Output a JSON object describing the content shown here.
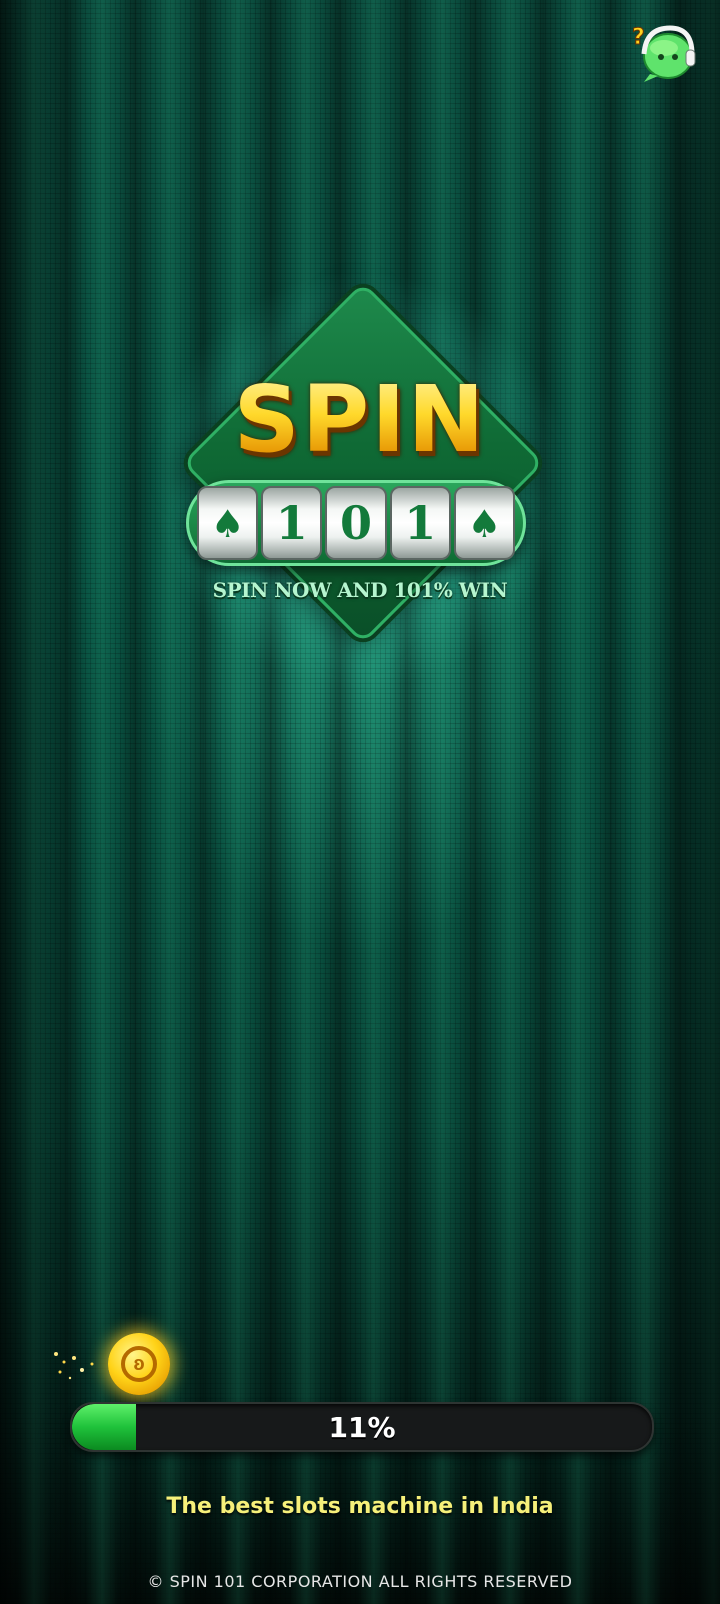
{
  "support": {
    "icon": "headset-support-icon",
    "accent": "#59e36a"
  },
  "logo": {
    "title": "SPIN",
    "reels": [
      "♠",
      "1",
      "0",
      "1",
      "♠"
    ],
    "tagline": "SPIN NOW AND 101% WIN"
  },
  "loading": {
    "progress_percent": 11,
    "progress_label": "11%",
    "coin_icon": "gold-coin-icon",
    "bar_color": "#1fc23b"
  },
  "subtitle": "The best slots machine in India",
  "footer": "© SPIN 101 CORPORATION ALL RIGHTS RESERVED"
}
